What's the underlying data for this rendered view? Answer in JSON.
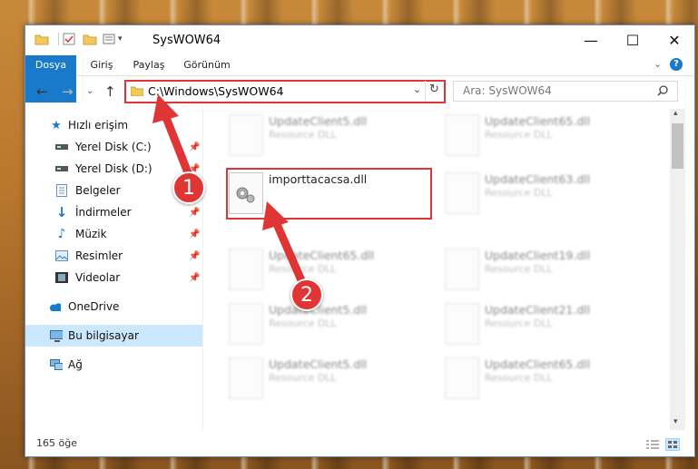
{
  "window": {
    "title": "SysWOW64",
    "minimize": "—",
    "maximize": "☐",
    "close": "✕"
  },
  "ribbon": {
    "tabs": [
      "Dosya",
      "Giriş",
      "Paylaş",
      "Görünüm"
    ],
    "expand_icon": "chevron-down",
    "help_icon": "?"
  },
  "nav": {
    "address": "C:\\Windows\\SysWOW64",
    "search_placeholder": "Ara: SysWOW64"
  },
  "sidebar": {
    "items": [
      {
        "label": "Hızlı erişim",
        "icon": "star-icon",
        "pinned": false
      },
      {
        "label": "Yerel Disk (C:)",
        "icon": "drive-icon",
        "pinned": true
      },
      {
        "label": "Yerel Disk (D:)",
        "icon": "drive-icon",
        "pinned": true
      },
      {
        "label": "Belgeler",
        "icon": "document-icon",
        "pinned": true
      },
      {
        "label": "İndirmeler",
        "icon": "download-icon",
        "pinned": true
      },
      {
        "label": "Müzik",
        "icon": "music-icon",
        "pinned": true
      },
      {
        "label": "Resimler",
        "icon": "pictures-icon",
        "pinned": true
      },
      {
        "label": "Videolar",
        "icon": "video-icon",
        "pinned": true
      },
      {
        "label": "OneDrive",
        "icon": "cloud-icon",
        "pinned": false
      },
      {
        "label": "Bu bilgisayar",
        "icon": "computer-icon",
        "pinned": false
      },
      {
        "label": "Ağ",
        "icon": "network-icon",
        "pinned": false
      }
    ]
  },
  "files": {
    "left": [
      {
        "name": "UpdateClient5.dll",
        "type": "Resource DLL"
      },
      {
        "name": "importtacacsa.dll",
        "type": ""
      },
      {
        "name": "UpdateClient65.dll",
        "type": "Resource DLL"
      },
      {
        "name": "UpdateClient5.dll",
        "type": "Resource DLL"
      },
      {
        "name": "UpdateClient5.dll",
        "type": "Resource DLL"
      }
    ],
    "right": [
      {
        "name": "UpdateClient65.dll",
        "type": "Resource DLL"
      },
      {
        "name": "UpdateClient63.dll",
        "type": "Resource DLL"
      },
      {
        "name": "UpdateClient19.dll",
        "type": "Resource DLL"
      },
      {
        "name": "UpdateClient21.dll",
        "type": "Resource DLL"
      },
      {
        "name": "UpdateClient65.dll",
        "type": "Resource DLL"
      }
    ]
  },
  "status": {
    "count": "165 öğe"
  },
  "annotations": {
    "step1": "1",
    "step2": "2",
    "color": "#e03535"
  }
}
